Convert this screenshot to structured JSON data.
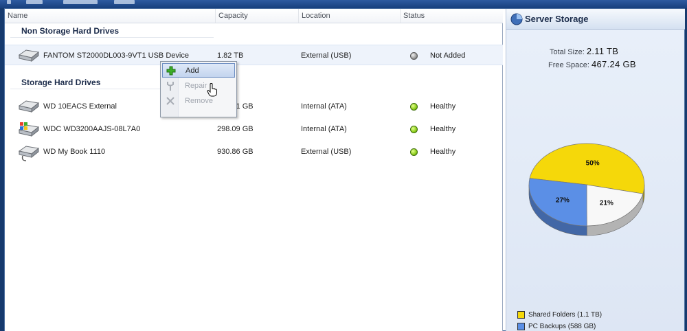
{
  "list": {
    "columns": [
      "Name",
      "Capacity",
      "Location",
      "Status"
    ],
    "groups": [
      {
        "title": "Non Storage Hard Drives",
        "drives": [
          {
            "name": "FANTOM ST2000DL003-9VT1 USB Device",
            "capacity": "1.82 TB",
            "location": "External (USB)",
            "status": "Not Added",
            "status_color": "#8a8a8a"
          }
        ]
      },
      {
        "title": "Storage Hard Drives",
        "drives": [
          {
            "name": "WD 10EACS External",
            "capacity": "931.51 GB",
            "location": "Internal (ATA)",
            "status": "Healthy",
            "status_color": "#7cc21a"
          },
          {
            "name": "WDC WD3200AAJS-08L7A0",
            "capacity": "298.09 GB",
            "location": "Internal (ATA)",
            "status": "Healthy",
            "status_color": "#7cc21a"
          },
          {
            "name": "WD My Book 1110",
            "capacity": "930.86 GB",
            "location": "External (USB)",
            "status": "Healthy",
            "status_color": "#7cc21a"
          }
        ]
      }
    ]
  },
  "context_menu": {
    "items": [
      {
        "label": "Add",
        "icon": "plus-icon",
        "enabled": true,
        "highlighted": true
      },
      {
        "label": "Repair",
        "icon": "wrench-icon",
        "enabled": false,
        "highlighted": false
      },
      {
        "label": "Remove",
        "icon": "x-icon",
        "enabled": false,
        "highlighted": false
      }
    ]
  },
  "server_storage": {
    "title": "Server Storage",
    "total_size_label": "Total Size:",
    "total_size": "2.11 TB",
    "free_space_label": "Free Space:",
    "free_space": "467.24 GB"
  },
  "chart_data": {
    "type": "pie",
    "title": "",
    "slices": [
      {
        "label": "50%",
        "value": 50,
        "color": "#f5d80a"
      },
      {
        "label": "21%",
        "value": 21,
        "color": "#f8f8f8"
      },
      {
        "label": "27%",
        "value": 27,
        "color": "#5b8fe6"
      }
    ],
    "legend": [
      {
        "label": "Shared Folders (1.1 TB)",
        "color": "#f5d80a"
      },
      {
        "label": "PC Backups (588 GB)",
        "color": "#5b8fe6"
      }
    ],
    "legend_placement": "bottom"
  }
}
